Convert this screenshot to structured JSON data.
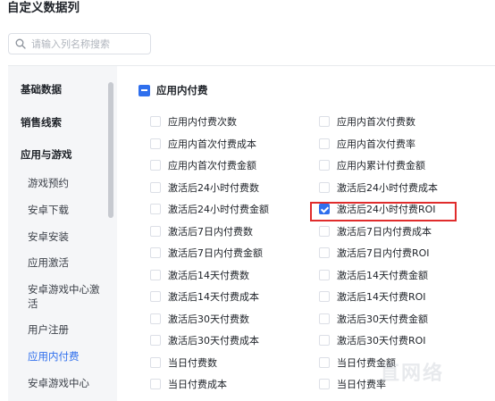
{
  "page": {
    "title": "自定义数据列"
  },
  "search": {
    "placeholder": "请输入列名称搜索"
  },
  "sidebar": {
    "items": [
      {
        "label": "基础数据"
      },
      {
        "label": "销售线索"
      },
      {
        "label": "应用与游戏"
      },
      {
        "label": "游戏预约"
      },
      {
        "label": "安卓下载"
      },
      {
        "label": "安卓安装"
      },
      {
        "label": "应用激活"
      },
      {
        "label": "安卓游戏中心激活"
      },
      {
        "label": "用户注册"
      },
      {
        "label": "应用内付费"
      },
      {
        "label": "安卓游戏中心"
      }
    ]
  },
  "group": {
    "title": "应用内付费",
    "state": "indeterminate"
  },
  "options": {
    "left": [
      {
        "label": "应用内付费次数",
        "checked": false
      },
      {
        "label": "应用内首次付费成本",
        "checked": false
      },
      {
        "label": "应用内首次付费金额",
        "checked": false
      },
      {
        "label": "激活后24小时付费数",
        "checked": false
      },
      {
        "label": "激活后24小时付费金额",
        "checked": false
      },
      {
        "label": "激活后7日内付费数",
        "checked": false
      },
      {
        "label": "激活后7日内付费金额",
        "checked": false
      },
      {
        "label": "激活后14天付费数",
        "checked": false
      },
      {
        "label": "激活后14天付费成本",
        "checked": false
      },
      {
        "label": "激活后30天付费数",
        "checked": false
      },
      {
        "label": "激活后30天付费成本",
        "checked": false
      },
      {
        "label": "当日付费数",
        "checked": false
      },
      {
        "label": "当日付费成本",
        "checked": false
      }
    ],
    "right": [
      {
        "label": "应用内首次付费数",
        "checked": false
      },
      {
        "label": "应用内首次付费率",
        "checked": false
      },
      {
        "label": "应用内累计付费金额",
        "checked": false
      },
      {
        "label": "激活后24小时付费成本",
        "checked": false
      },
      {
        "label": "激活后24小时付费ROI",
        "checked": true
      },
      {
        "label": "激活后7日内付费成本",
        "checked": false
      },
      {
        "label": "激活后7日内付费ROI",
        "checked": false
      },
      {
        "label": "激活后14天付费金额",
        "checked": false
      },
      {
        "label": "激活后14天付费ROI",
        "checked": false
      },
      {
        "label": "激活后30天付费金额",
        "checked": false
      },
      {
        "label": "激活后30天付费ROI",
        "checked": false
      },
      {
        "label": "当日付费金额",
        "checked": false
      },
      {
        "label": "当日付费率",
        "checked": false
      }
    ]
  },
  "colors": {
    "accent": "#2f6fed",
    "highlight": "#e02c2c",
    "sidebar_bg": "#f5f6f8"
  },
  "icons": {
    "search": "search-icon"
  },
  "watermark": "直网络"
}
